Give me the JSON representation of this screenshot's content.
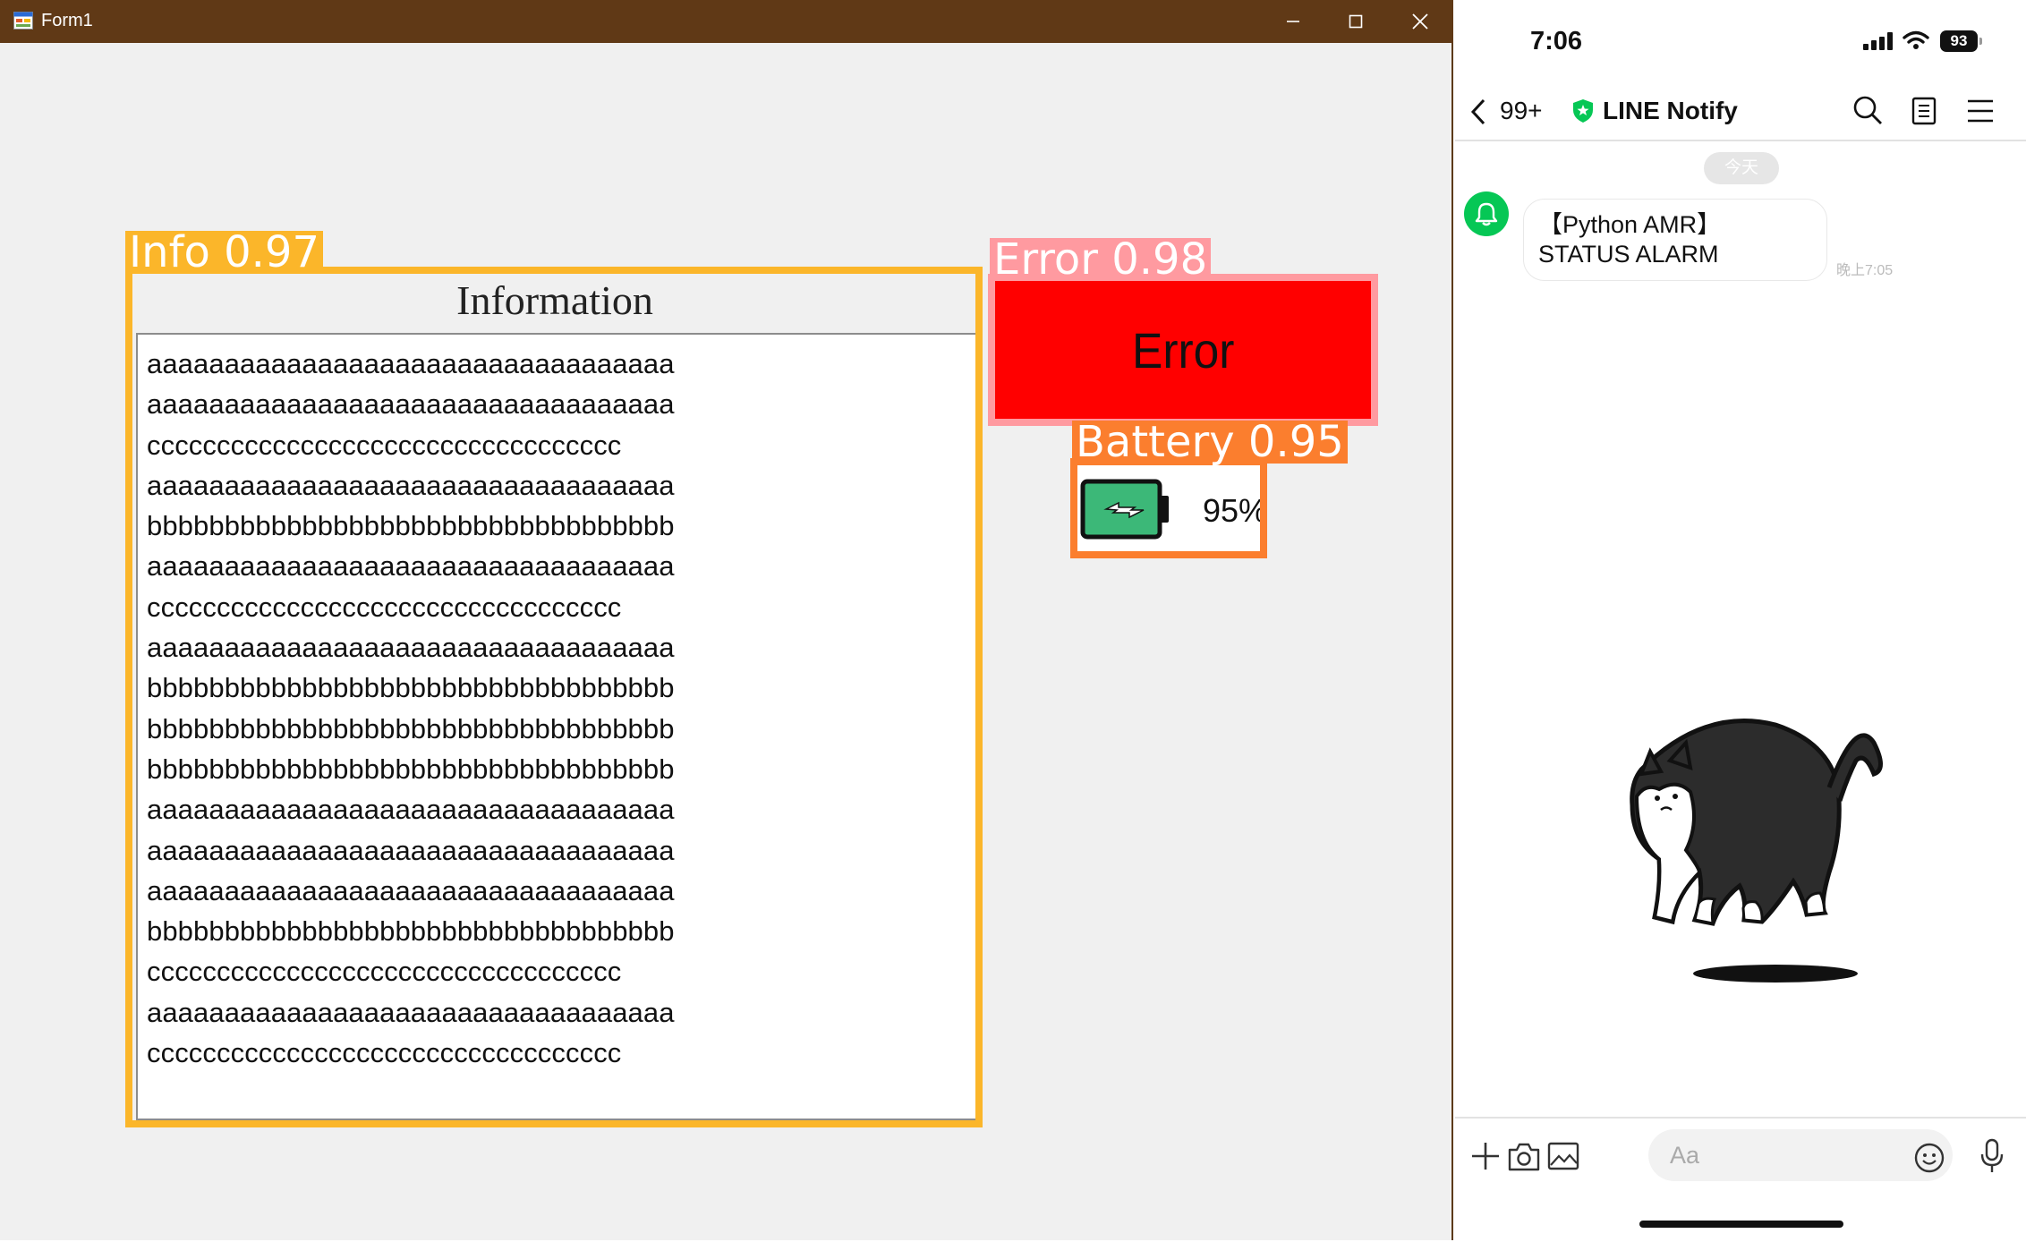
{
  "window": {
    "title": "Form1",
    "icon": "form-app-icon",
    "controls": [
      "minimize-icon",
      "maximize-icon",
      "close-icon"
    ]
  },
  "detections": {
    "info": "Info 0.97",
    "error": "Error 0.98",
    "battery": "Battery 0.95"
  },
  "information_group": {
    "title": "Information",
    "lines": [
      "aaaaaaaaaaaaaaaaaaaaaaaaaaaaaaaaaa",
      "aaaaaaaaaaaaaaaaaaaaaaaaaaaaaaaaaa",
      "cccccccccccccccccccccccccccccccccc",
      "aaaaaaaaaaaaaaaaaaaaaaaaaaaaaaaaaa",
      "bbbbbbbbbbbbbbbbbbbbbbbbbbbbbbbbbb",
      "aaaaaaaaaaaaaaaaaaaaaaaaaaaaaaaaaa",
      "cccccccccccccccccccccccccccccccccc",
      "aaaaaaaaaaaaaaaaaaaaaaaaaaaaaaaaaa",
      "bbbbbbbbbbbbbbbbbbbbbbbbbbbbbbbbbb",
      "bbbbbbbbbbbbbbbbbbbbbbbbbbbbbbbbbb",
      "bbbbbbbbbbbbbbbbbbbbbbbbbbbbbbbbbb",
      "aaaaaaaaaaaaaaaaaaaaaaaaaaaaaaaaaa",
      "aaaaaaaaaaaaaaaaaaaaaaaaaaaaaaaaaa",
      "aaaaaaaaaaaaaaaaaaaaaaaaaaaaaaaaaa",
      "bbbbbbbbbbbbbbbbbbbbbbbbbbbbbbbbbb",
      "cccccccccccccccccccccccccccccccccc",
      "aaaaaaaaaaaaaaaaaaaaaaaaaaaaaaaaaa",
      "cccccccccccccccccccccccccccccccccc"
    ]
  },
  "error_panel": {
    "text": "Error",
    "color": "#ff0000"
  },
  "battery": {
    "percent_text": "95%",
    "level": 0.95,
    "icon": "battery-charging-icon",
    "color": "#3cb878"
  },
  "colors": {
    "titlebar": "#603916",
    "info": "#fbb62a",
    "error": "#ff9aa0",
    "battery": "#fb7e2e",
    "line_green": "#06c755"
  },
  "phone": {
    "status": {
      "time": "7:06",
      "battery": "93"
    },
    "header": {
      "unread": "99+",
      "chat_name": "LINE Notify"
    },
    "date_chip": "今天",
    "message": {
      "text": "【Python AMR】STATUS ALARM",
      "time": "晚上7:05"
    },
    "sticker": "cat-sticker",
    "input": {
      "placeholder": "Aa"
    }
  }
}
